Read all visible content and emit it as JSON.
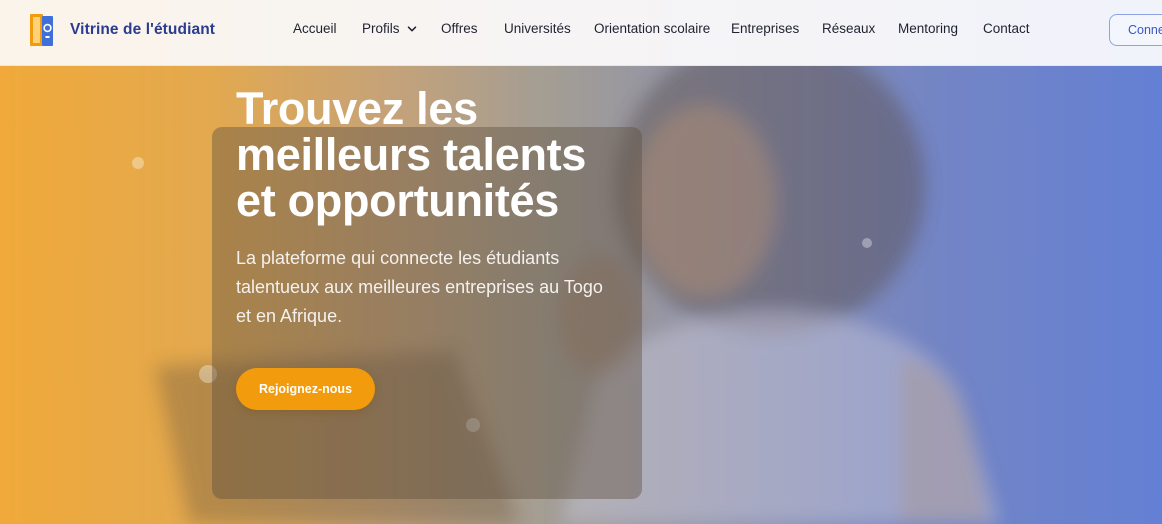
{
  "brand": {
    "name": "Vitrine de l'étudiant",
    "logo_icon": "door-logo-icon"
  },
  "nav": {
    "items": [
      {
        "label": "Accueil"
      },
      {
        "label": "Profils",
        "has_dropdown": true
      },
      {
        "label": "Offres"
      },
      {
        "label": "Universités"
      },
      {
        "label": "Orientation scolaire"
      },
      {
        "label": "Entreprises"
      },
      {
        "label": "Réseaux"
      },
      {
        "label": "Mentoring"
      },
      {
        "label": "Contact"
      }
    ],
    "login_label": "Connexion"
  },
  "hero": {
    "title": "Trouvez les meilleurs talents et opportunités",
    "subtitle": "La plateforme qui connecte les étudiants talentueux aux meilleures entreprises au Togo et en Afrique.",
    "cta_label": "Rejoignez-nous"
  },
  "colors": {
    "brand_text": "#2a3c8f",
    "accent_orange": "#f29b0c",
    "accent_blue": "#6480d4",
    "login_border": "#8ea3e6"
  }
}
